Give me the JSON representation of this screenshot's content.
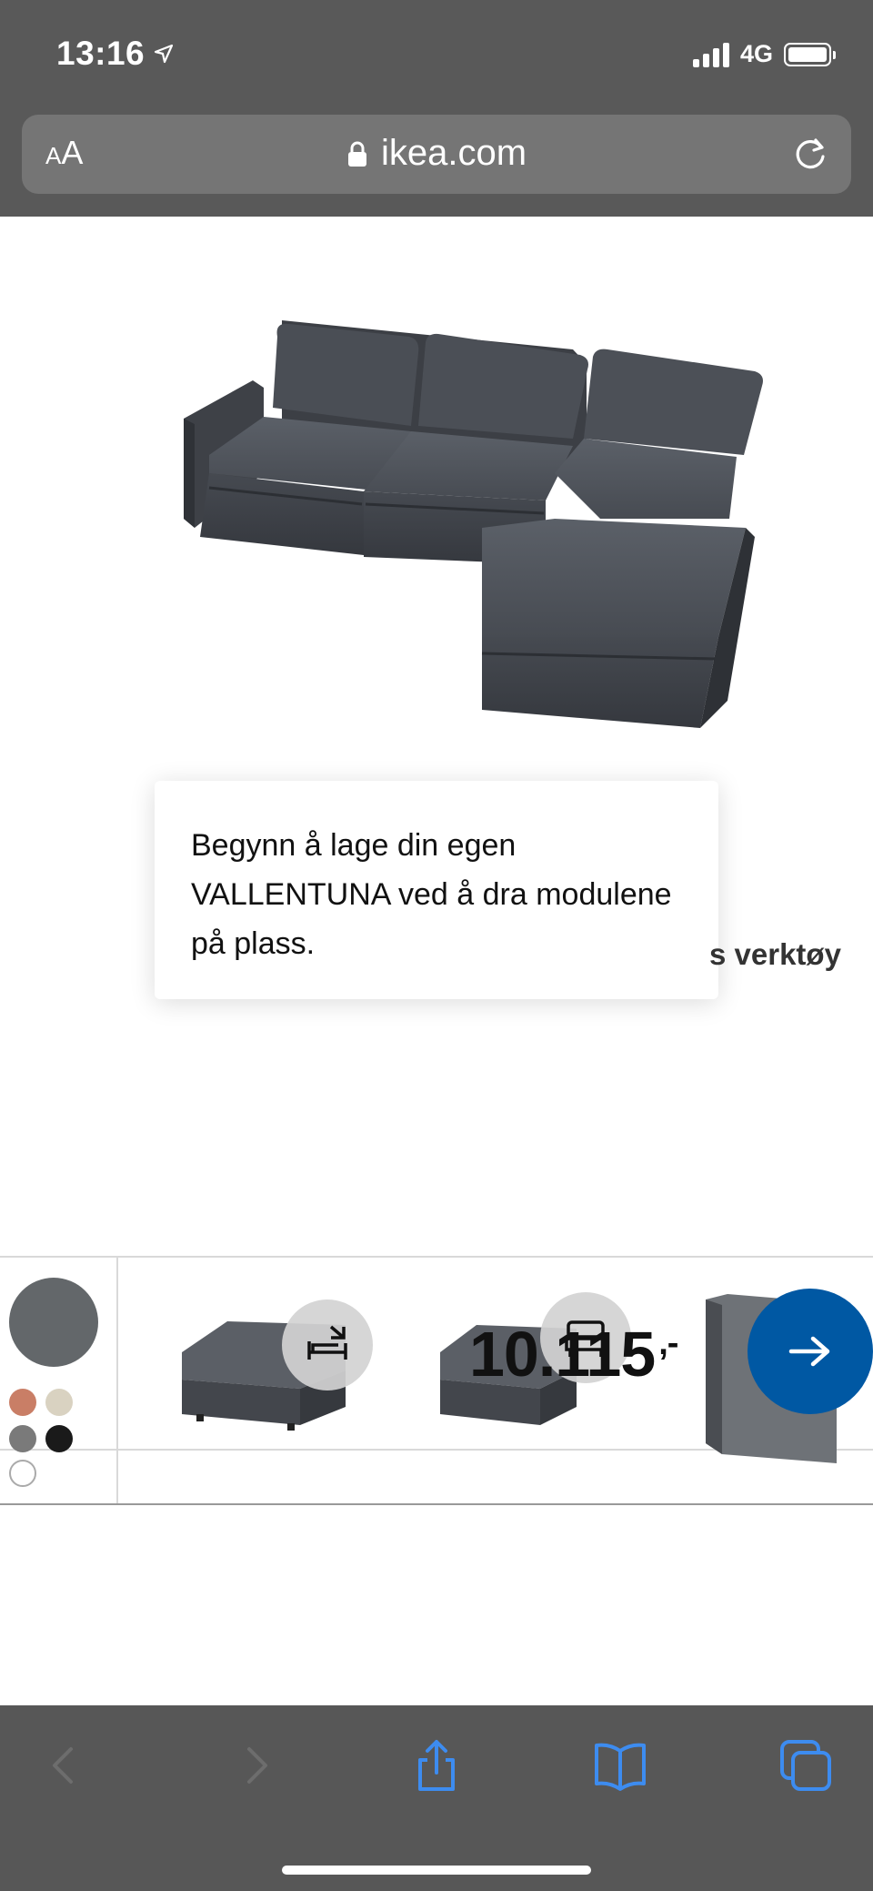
{
  "status_bar": {
    "time": "13:16",
    "network": "4G"
  },
  "browser": {
    "text_size_label_small": "A",
    "text_size_label_large": "A",
    "url": "ikea.com"
  },
  "planner": {
    "tooltip": "Begynn å lage din egen VALLENTUNA ved å dra modulene på plass.",
    "tools_label": "s verktøy"
  },
  "module_strip": {
    "price": "10.115",
    "price_suffix": ",-",
    "swatches": [
      "#c97e66",
      "#d9d2c1",
      "#7a7a7a",
      "#1a1a1a",
      "#ffffff"
    ],
    "selected_color": "#63676a"
  },
  "colors": {
    "accent": "#0058a3",
    "chrome": "#595959"
  }
}
